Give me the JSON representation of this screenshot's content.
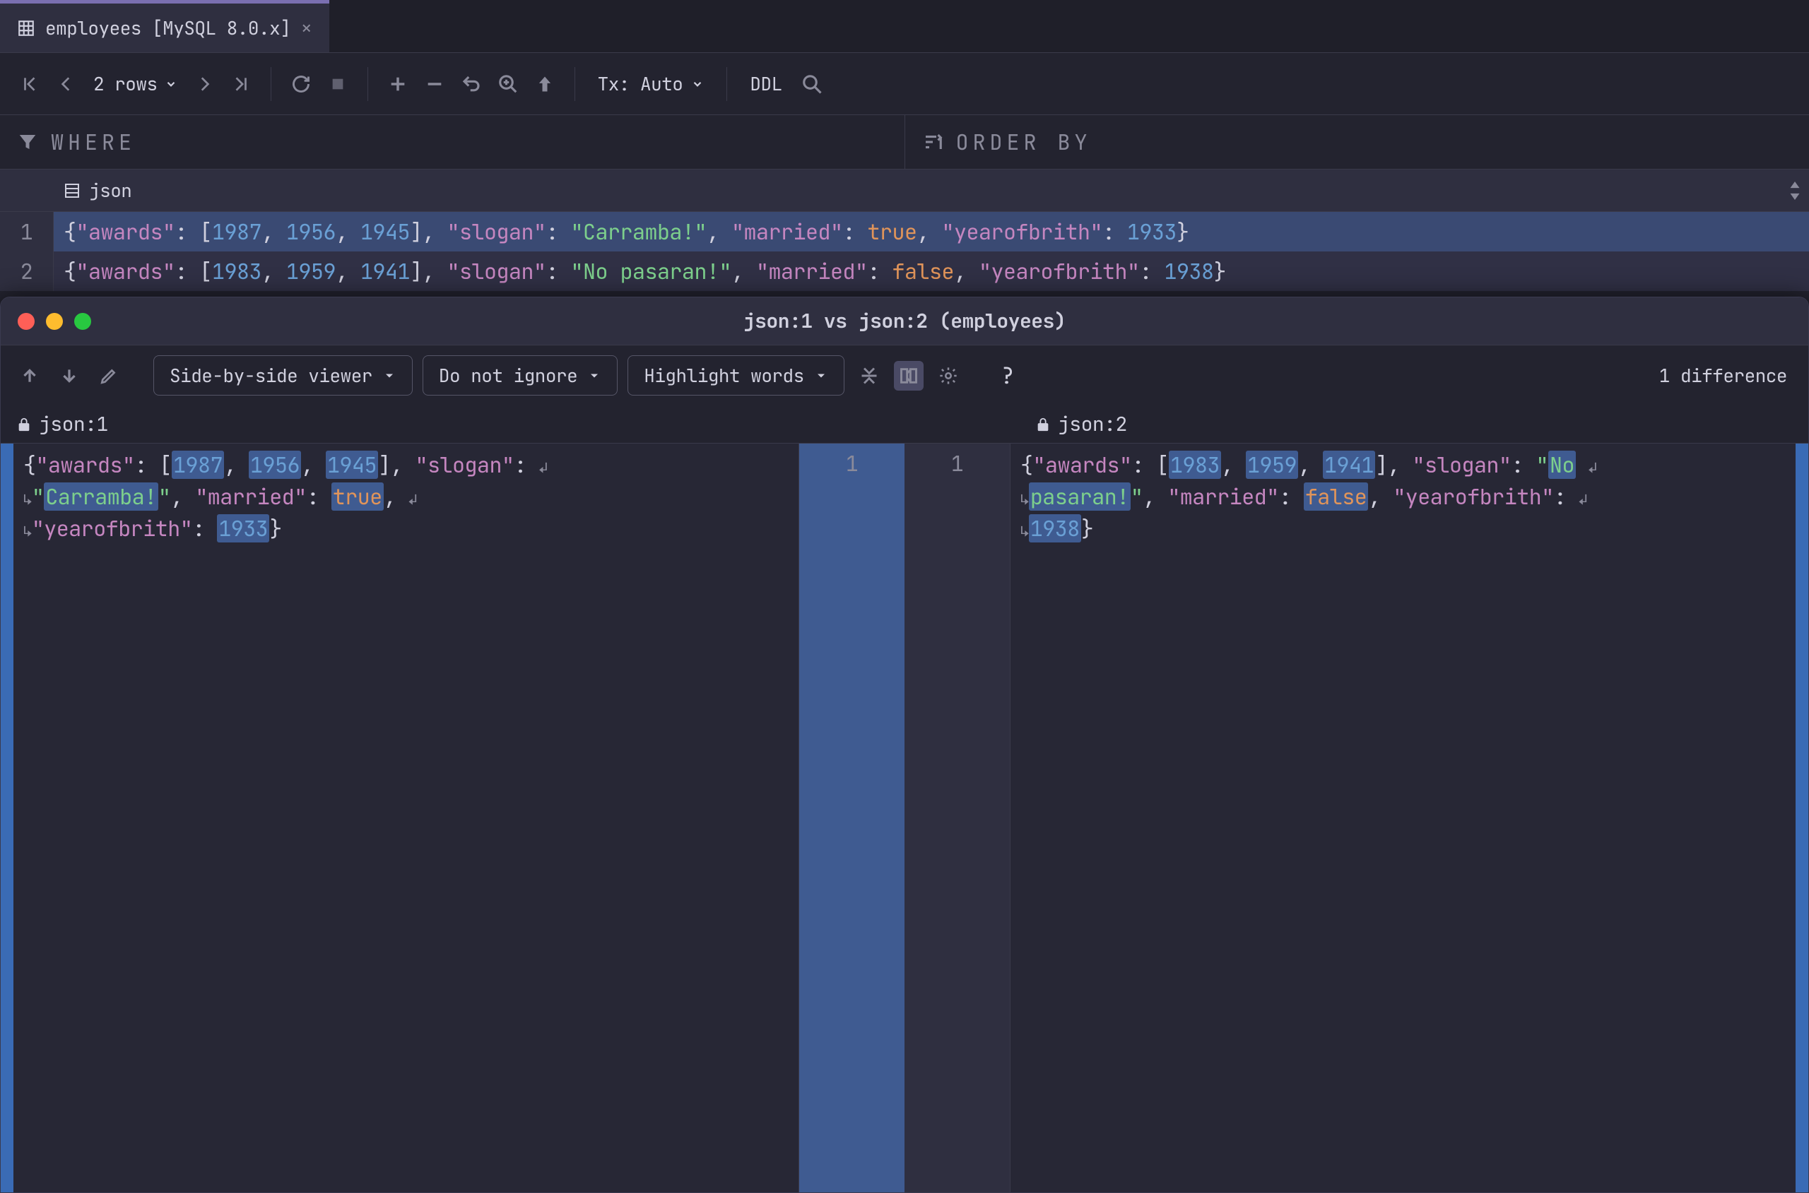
{
  "tab": {
    "title": "employees [MySQL 8.0.x]"
  },
  "toolbar": {
    "rows_label": "2 rows",
    "tx_label": "Tx: Auto",
    "ddl_label": "DDL"
  },
  "filters": {
    "where_label": "WHERE",
    "order_label": "ORDER BY"
  },
  "grid": {
    "column": "json",
    "rows": [
      {
        "num": "1",
        "awards": [
          1987,
          1956,
          1945
        ],
        "slogan": "Carramba!",
        "married": "true",
        "yearofbrith": 1933
      },
      {
        "num": "2",
        "awards": [
          1983,
          1959,
          1941
        ],
        "slogan": "No pasaran!",
        "married": "false",
        "yearofbrith": 1938
      }
    ]
  },
  "dialog": {
    "title": "json:1 vs json:2 (employees)",
    "left_file": "json:1",
    "right_file": "json:2",
    "viewer_mode": "Side-by-side viewer",
    "ignore_mode": "Do not ignore",
    "highlight_mode": "Highlight words",
    "diff_count": "1 difference",
    "gutter_left": "1",
    "gutter_right": "1",
    "left": {
      "awards": [
        1987,
        1956,
        1945
      ],
      "slogan": "Carramba!",
      "married": "true",
      "yearofbrith": 1933
    },
    "right": {
      "awards": [
        1983,
        1959,
        1941
      ],
      "slogan": "No pasaran!",
      "married": "false",
      "yearofbrith": 1938
    }
  }
}
